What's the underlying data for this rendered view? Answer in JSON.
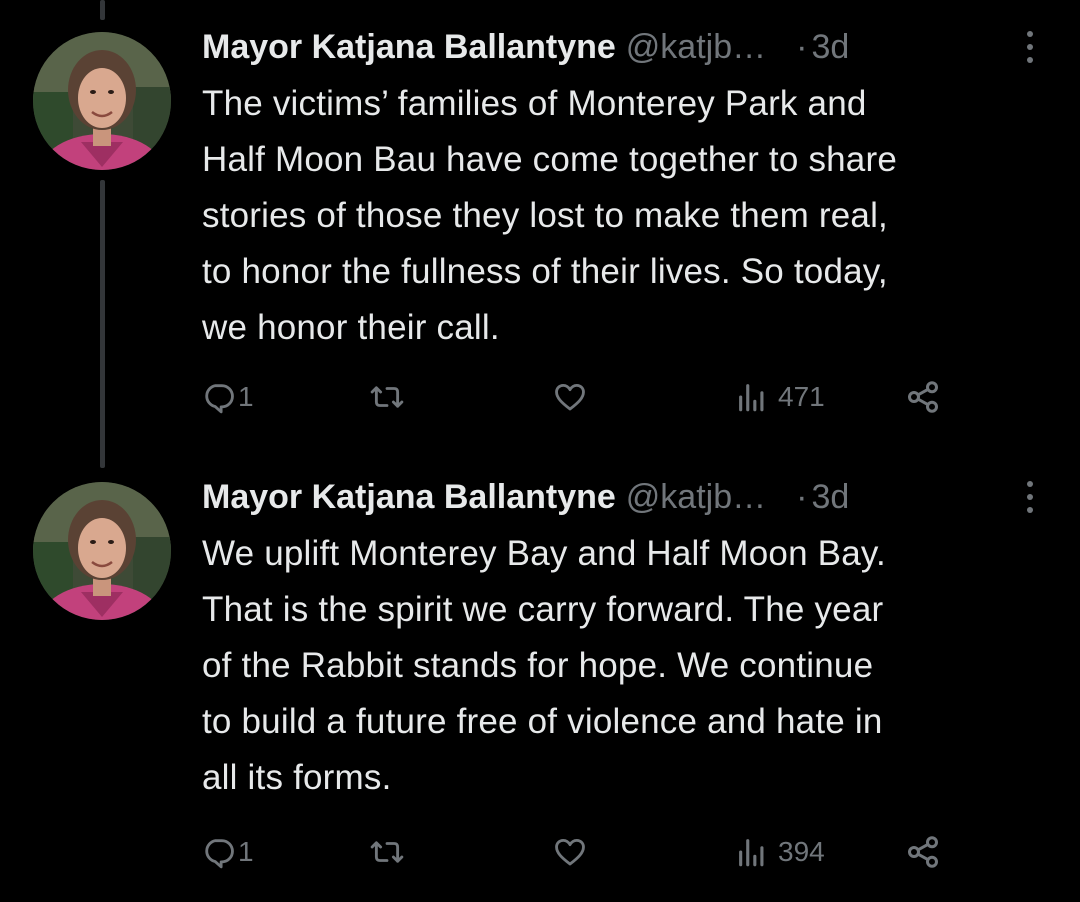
{
  "tweets": [
    {
      "display_name": "Mayor Katjana Ballantyne",
      "handle": "@katjb…",
      "separator": "·",
      "time": "3d",
      "text_lines": [
        "The victims’ families of Monterey Park and",
        "Half Moon Bau have come together to share",
        "stories of those they lost to make them real,",
        "to honor the fullness of their lives. So today,",
        "we honor their call."
      ],
      "reply_count": "1",
      "retweet_count": "",
      "like_count": "",
      "views": "471"
    },
    {
      "display_name": "Mayor Katjana Ballantyne",
      "handle": "@katjb…",
      "separator": "·",
      "time": "3d",
      "text_lines": [
        "We uplift Monterey Bay and Half Moon Bay.",
        "That is the spirit we carry forward. The year",
        "of the Rabbit stands for hope. We continue",
        "to build a future free of violence and hate in",
        "all its forms."
      ],
      "reply_count": "1",
      "retweet_count": "",
      "like_count": "",
      "views": "394"
    }
  ],
  "colors": {
    "background": "#000000",
    "text": "#e7e9ea",
    "secondary": "#71767b",
    "thread_line": "#333639"
  },
  "icons": [
    "reply-icon",
    "retweet-icon",
    "like-icon",
    "views-icon",
    "share-icon",
    "more-icon"
  ]
}
